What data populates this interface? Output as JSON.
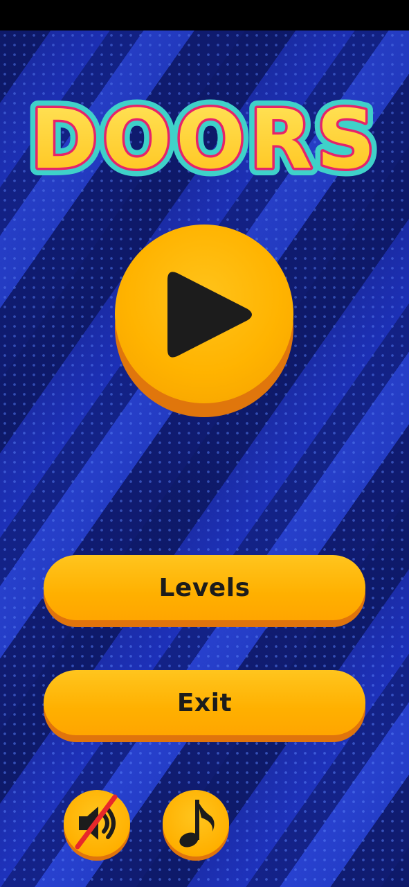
{
  "game": {
    "title": "DOORS"
  },
  "menu": {
    "play": {
      "icon": "play-icon"
    },
    "levels_label": "Levels",
    "exit_label": "Exit",
    "sound": {
      "icon": "speaker-muted-icon",
      "state": "muted"
    },
    "music": {
      "icon": "music-note-icon"
    }
  },
  "colors": {
    "button_face": "#ffb300",
    "button_shadow": "#e0740c",
    "title_fill": "#ffcf2e",
    "title_outline": "#e6236a",
    "title_glow": "#3fd1c9",
    "background": "#1d2fb0"
  }
}
